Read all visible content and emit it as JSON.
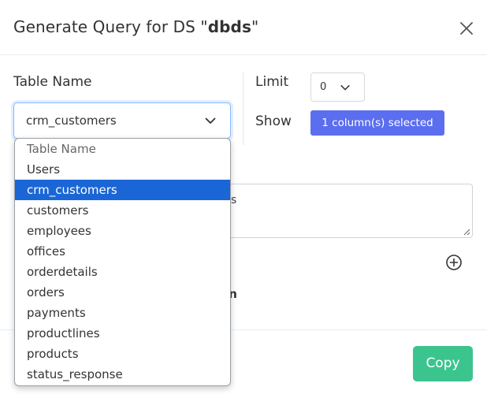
{
  "dialog": {
    "title_prefix": "Generate Query for DS \"",
    "title_ds": "dbds",
    "title_suffix": "\""
  },
  "labels": {
    "table_name": "Table Name",
    "limit": "Limit",
    "show": "Show"
  },
  "table_select": {
    "value": "crm_customers"
  },
  "limit_select": {
    "value": "0"
  },
  "columns_button": {
    "label": "1 column(s) selected"
  },
  "partial": {
    "textarea_fragment": "s",
    "bold_fragment": "on"
  },
  "footer": {
    "copy_label": "Copy"
  },
  "dropdown": {
    "options": [
      "Table Name",
      "Users",
      "crm_customers",
      "customers",
      "employees",
      "offices",
      "orderdetails",
      "orders",
      "payments",
      "productlines",
      "products",
      "status_response"
    ],
    "selected_index": 2
  },
  "colors": {
    "accent": "#5b6ef0",
    "selected": "#1a66d6",
    "copy": "#3cc48f"
  },
  "icons": {
    "close": "close-icon",
    "chevron": "chevron-down-icon",
    "plus": "plus-circle-icon"
  }
}
